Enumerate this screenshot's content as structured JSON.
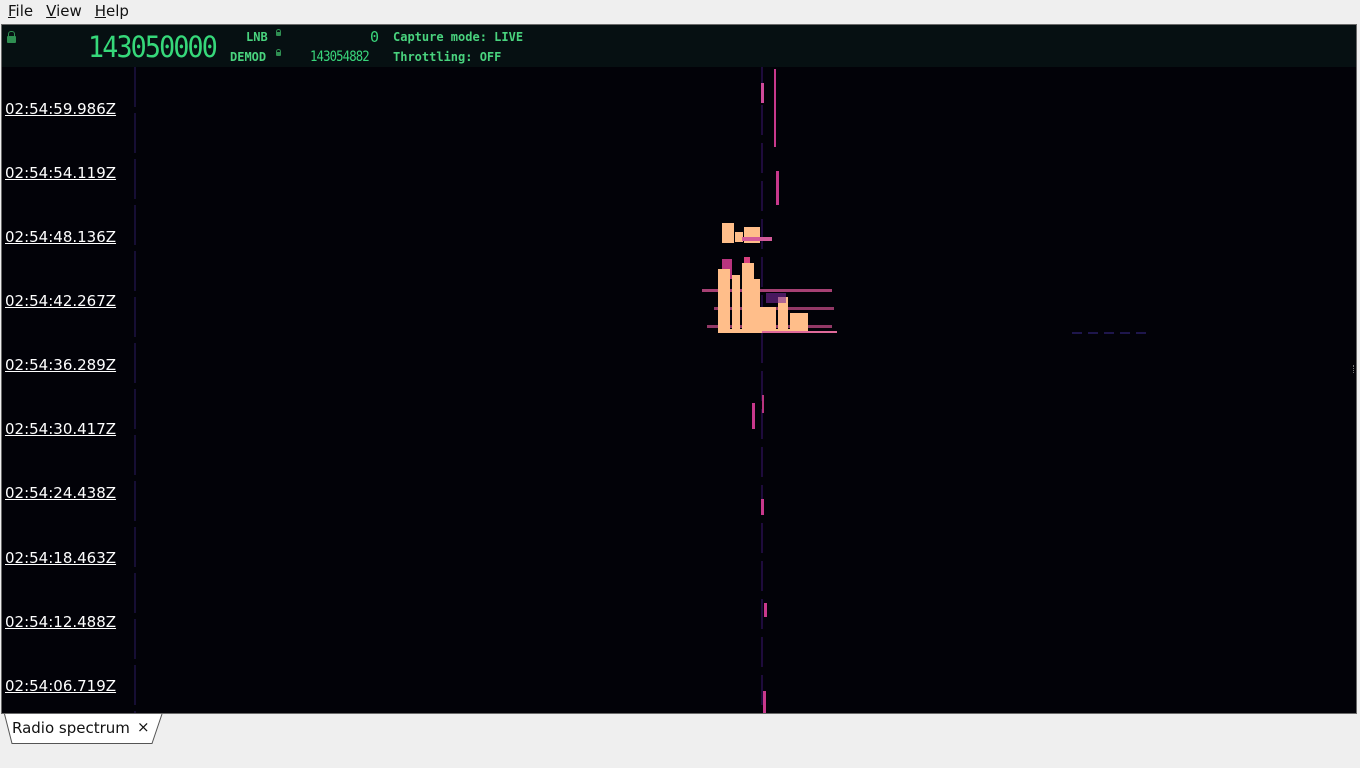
{
  "menu": {
    "items": [
      {
        "mnemonic": "F",
        "rest": "ile"
      },
      {
        "mnemonic": "V",
        "rest": "iew"
      },
      {
        "mnemonic": "H",
        "rest": "elp"
      }
    ]
  },
  "status": {
    "main_frequency": "143050000",
    "lnb_label": "LNB",
    "lnb_value": "0",
    "demod_label": "DEMOD",
    "demod_value": "143054882",
    "capture_mode": "Capture mode: LIVE",
    "throttling": "Throttling: OFF"
  },
  "waterfall": {
    "timestamps": [
      "02:54:59.986Z",
      "02:54:54.119Z",
      "02:54:48.136Z",
      "02:54:42.267Z",
      "02:54:36.289Z",
      "02:54:30.417Z",
      "02:54:24.438Z",
      "02:54:18.463Z",
      "02:54:12.488Z",
      "02:54:06.719Z"
    ],
    "colors": {
      "background": "#020208",
      "strong_signal": "#ffbe8a",
      "medium_signal": "#c8388c",
      "weak_signal": "#4a1a8a"
    }
  },
  "tabs": [
    {
      "label": "Radio spectrum",
      "close": "×"
    }
  ]
}
